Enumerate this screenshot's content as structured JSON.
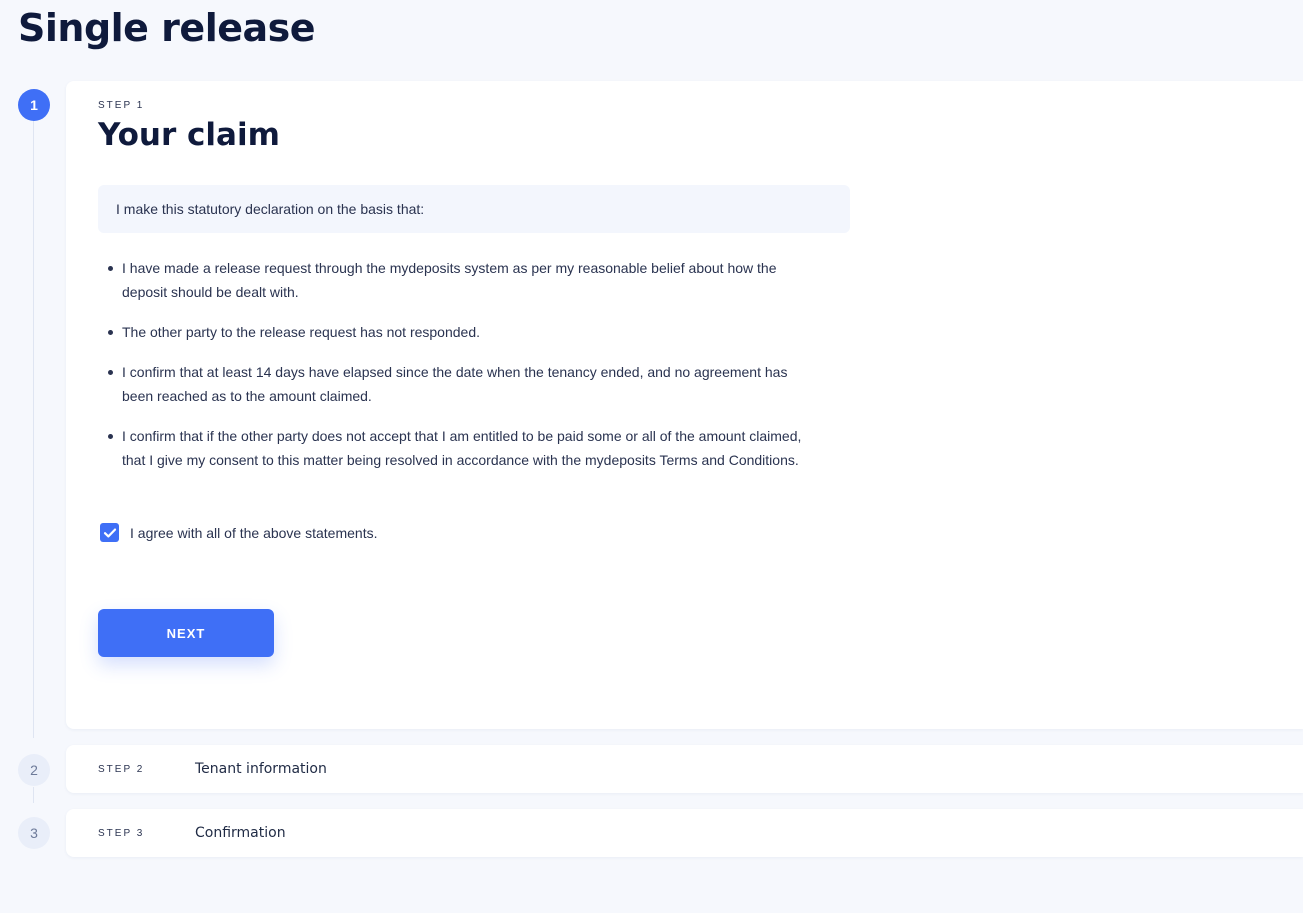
{
  "page": {
    "title": "Single release"
  },
  "steps": [
    {
      "number": "1",
      "kicker": "STEP 1",
      "title": "Your claim",
      "active": true
    },
    {
      "number": "2",
      "kicker": "STEP 2",
      "title": "Tenant information",
      "active": false
    },
    {
      "number": "3",
      "kicker": "STEP 3",
      "title": "Confirmation",
      "active": false
    }
  ],
  "claim": {
    "declaration": "I make this statutory declaration on the basis that:",
    "statements": [
      "I have made a release request through the mydeposits system as per my reasonable belief about how the deposit should be dealt with.",
      "The other party to the release request has not responded.",
      "I confirm that at least 14 days have elapsed since the date when the tenancy ended, and no agreement has been reached as to the amount claimed.",
      "I confirm that if the other party does not accept that I am entitled to be paid some or all of the amount claimed, that I give my consent to this matter being resolved in accordance with the mydeposits Terms and Conditions."
    ],
    "agree_label": "I agree with all of the above statements.",
    "agree_checked": true,
    "next_label": "NEXT"
  },
  "icons": {
    "check": "check-icon"
  },
  "colors": {
    "accent": "#3f6ff6",
    "heading": "#0f1a3c",
    "background": "#f6f8fd"
  }
}
